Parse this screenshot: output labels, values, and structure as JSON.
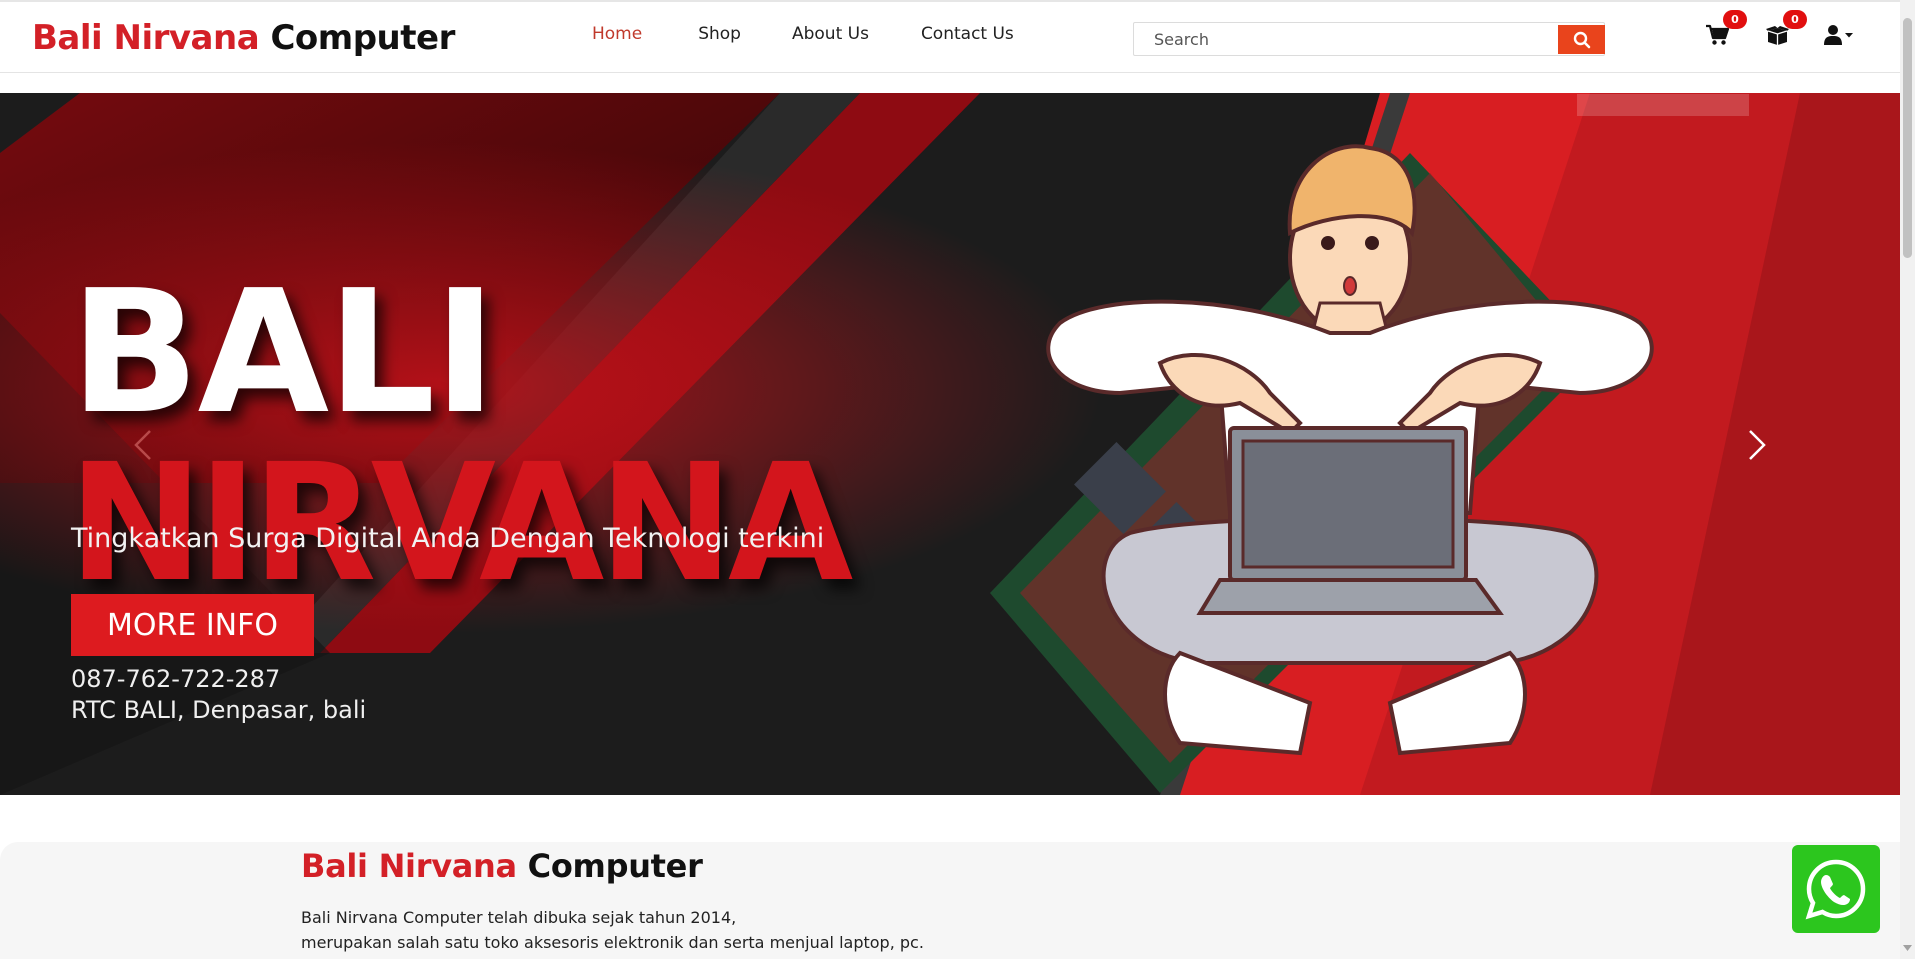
{
  "brand": {
    "part1": "Bali Nirvana",
    "part2": "Computer"
  },
  "nav": [
    {
      "label": "Home",
      "active": true
    },
    {
      "label": "Shop",
      "active": false
    },
    {
      "label": "About Us",
      "active": false
    },
    {
      "label": "Contact Us",
      "active": false
    }
  ],
  "search": {
    "placeholder": "Search",
    "value": ""
  },
  "cart": {
    "icon": "cart-icon",
    "count": "0"
  },
  "orders": {
    "icon": "box-icon",
    "count": "0"
  },
  "account": {
    "icon": "user-icon"
  },
  "hero": {
    "title1": "BALI",
    "title2": "NIRVANA",
    "tagline": "Tingkatkan Surga Digital Anda Dengan Teknologi terkini",
    "button": "MORE INFO",
    "phone": "087-762-722-287",
    "address": "RTC BALI, Denpasar, bali"
  },
  "about": {
    "title1": "Bali Nirvana",
    "title2": "Computer",
    "line1": "Bali Nirvana Computer telah dibuka sejak tahun 2014,",
    "line2": "merupakan salah satu toko aksesoris elektronik dan serta menjual laptop, pc."
  },
  "colors": {
    "brand_red": "#d32027",
    "search_button": "#e9441c",
    "badge": "#e10f0f",
    "whatsapp": "#2cc61e"
  }
}
